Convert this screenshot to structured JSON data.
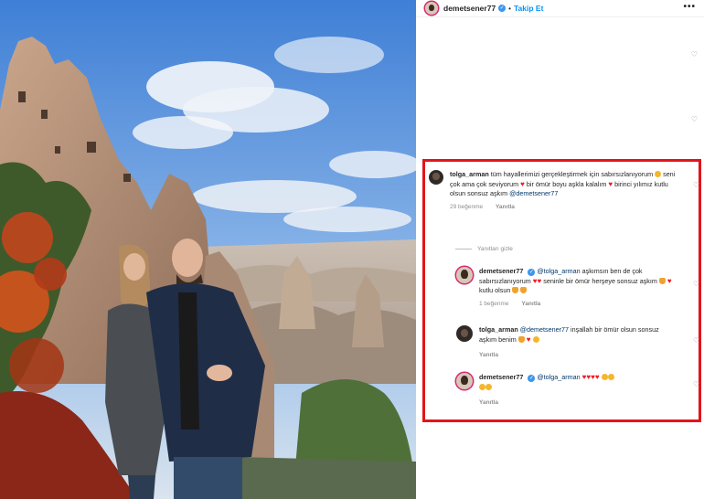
{
  "post": {
    "username": "demetsener77",
    "follow_label": "Takip Et",
    "more_label": "•••",
    "separator": "•"
  },
  "comments": [
    {
      "username": "tolga_arman",
      "text_parts": [
        "tüm hayallerimizi gerçekleştirmek için sabırsızlanıyorum",
        "seni çok ama çok seviyorum",
        "bir ömür boyu aşkla kalalım",
        "birinci yılımız kutlu olsun sonsuz aşkım"
      ],
      "mention": "@demetsener77",
      "likes": "29 beğenme",
      "reply_label": "Yanıtla"
    },
    {
      "username": "demetsener77",
      "mention": "@tolga_arman",
      "text_parts": [
        "aşkımsın ben de çok sabırsızlanıyorum",
        "seninle bir ömür herşeye sonsuz aşkım",
        "kutlu olsun"
      ],
      "likes": "1 beğenme",
      "reply_label": "Yanıtla"
    },
    {
      "username": "tolga_arman",
      "mention": "@demetsener77",
      "text_parts": [
        "inşallah bir ömür olsun sonsuz aşkım benim"
      ],
      "reply_label": "Yanıtla"
    },
    {
      "username": "demetsener77",
      "mention": "@tolga_arman",
      "text_parts": [],
      "reply_label": "Yanıtla"
    }
  ],
  "view_replies_label": "Yanıtları gizle",
  "colors": {
    "highlight_border": "#e3141b",
    "link_blue": "#0095f6",
    "mention": "#00376b",
    "heart": "#ed1b24"
  },
  "icons": [
    "heart-icon",
    "verified-icon",
    "more-icon",
    "avatar"
  ]
}
